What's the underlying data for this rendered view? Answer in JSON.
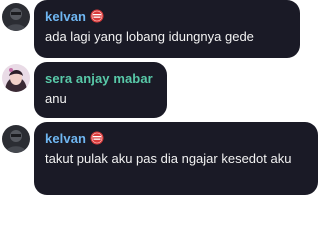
{
  "colors": {
    "bubble_bg": "#1a1a26",
    "name_kelvan": "#6fb6f2",
    "name_sera": "#58c9a8",
    "message_text": "#f2f2f2",
    "badge_red": "#d93a3a"
  },
  "messages": [
    {
      "author": "kelvan",
      "badge_icon": "role-badge-icon",
      "text": "ada lagi yang lobang idungnya gede"
    },
    {
      "author": "sera anjay mabar",
      "text": "anu"
    },
    {
      "author": "kelvan",
      "badge_icon": "role-badge-icon",
      "text": "takut pulak aku pas dia ngajar kesedot aku"
    }
  ]
}
